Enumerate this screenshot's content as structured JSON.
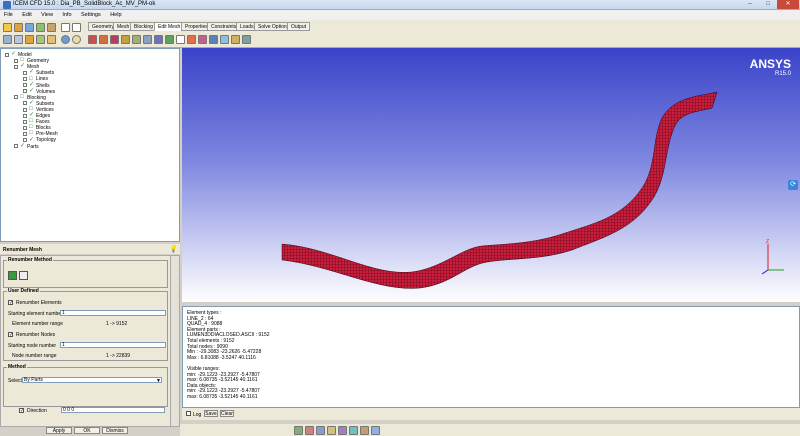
{
  "window": {
    "title": "ICEM CFD 15.0 : Dia_PB_SolidBlock_Ac_MV_PM-ok"
  },
  "menu": [
    "File",
    "Edit",
    "View",
    "Info",
    "Settings",
    "Help"
  ],
  "tabs": [
    "Geometry",
    "Mesh",
    "Blocking",
    "Edit Mesh",
    "Properties",
    "Constraints",
    "Loads",
    "Solve Options",
    "Output"
  ],
  "active_tab": "Edit Mesh",
  "tree": [
    {
      "label": "Model",
      "checked": true,
      "depth": 0
    },
    {
      "label": "Geometry",
      "checked": false,
      "depth": 1
    },
    {
      "label": "Mesh",
      "checked": true,
      "depth": 1
    },
    {
      "label": "Subsets",
      "checked": true,
      "depth": 2
    },
    {
      "label": "Lines",
      "checked": false,
      "depth": 2
    },
    {
      "label": "Shells",
      "checked": true,
      "depth": 2
    },
    {
      "label": "Volumes",
      "checked": true,
      "depth": 2
    },
    {
      "label": "Blocking",
      "checked": false,
      "depth": 1
    },
    {
      "label": "Subsets",
      "checked": true,
      "depth": 2
    },
    {
      "label": "Vertices",
      "checked": false,
      "depth": 2
    },
    {
      "label": "Edges",
      "checked": true,
      "depth": 2
    },
    {
      "label": "Faces",
      "checked": false,
      "depth": 2
    },
    {
      "label": "Blocks",
      "checked": false,
      "depth": 2
    },
    {
      "label": "Pre-Mesh",
      "checked": false,
      "depth": 2
    },
    {
      "label": "Topology",
      "checked": true,
      "depth": 2
    },
    {
      "label": "Parts",
      "checked": true,
      "depth": 1
    }
  ],
  "panel": {
    "title": "Renumber Mesh",
    "method_group": "Renumber Method",
    "user_defined": "User Defined",
    "renumber_elements": "Renumber Elements",
    "start_elem_label": "Starting element number",
    "start_elem_value": "1",
    "elem_range_label": "Element number range",
    "elem_range_value": "1 -> 9152",
    "renumber_nodes": "Renumber Nodes",
    "start_node_label": "Starting node number",
    "start_node_value": "1",
    "node_range_label": "Node number range",
    "node_range_value": "1 -> 22839",
    "method_title": "Method",
    "select_label": "Select",
    "select_value": "By Parts",
    "direction_label": "Direction",
    "direction_value": "0 0 0",
    "apply": "Apply",
    "ok": "OK",
    "dismiss": "Dismiss"
  },
  "viewport": {
    "logo": "ANSYS",
    "version": "R15.0"
  },
  "messages": [
    "Element types :",
    "   LINE_2 : 64",
    "   QUAD_4 : 9088",
    "Element parts :",
    "   LUMEN3DDIACLOSED.ASCII : 9152",
    "Total elements : 9152",
    "Total nodes : 9090",
    "Min : -29.3083 -23.2626 -5.47228",
    "Max : 6.81088 -3.5247 40.1116",
    "",
    "Visible ranges:",
    "   min: -29.1223 -23.2927 -5.47807",
    "   max: 6.08735 -3.52145 40.1161",
    "Data objects:",
    "   min: -29.1223 -23.2927 -5.47807",
    "   max: 6.08735 -3.52145 40.1161"
  ],
  "msg_controls": {
    "log": "Log",
    "save": "Save",
    "clear": "Clear"
  },
  "colors": {
    "mesh": "#c81e3c",
    "mesh_lines": "#3a0010"
  }
}
